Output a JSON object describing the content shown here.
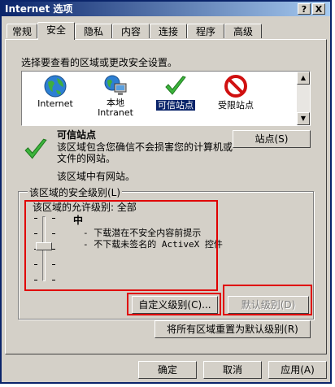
{
  "window": {
    "title": "Internet 选项",
    "help_label": "?",
    "close_label": "X"
  },
  "tabs": [
    {
      "label": "常规"
    },
    {
      "label": "安全"
    },
    {
      "label": "隐私"
    },
    {
      "label": "内容"
    },
    {
      "label": "连接"
    },
    {
      "label": "程序"
    },
    {
      "label": "高级"
    }
  ],
  "active_tab": "安全",
  "security": {
    "instruction": "选择要查看的区域或更改安全设置。",
    "zones": [
      {
        "label": "Internet",
        "icon": "globe-icon"
      },
      {
        "label": "本地\nIntranet",
        "icon": "intranet-icon"
      },
      {
        "label": "可信站点",
        "icon": "checkmark-icon",
        "selected": true
      },
      {
        "label": "受限站点",
        "icon": "restricted-icon"
      }
    ],
    "zone_title": "可信站点",
    "zone_desc_line1": "该区域包含您确信不会损害您的计算机或",
    "zone_desc_line2": "文件的网站。",
    "zone_status": "该区域中有网站。",
    "sites_button": "站点(S)",
    "group_title": "该区域的安全级别(L)",
    "allowed_levels": "该区域的允许级别: 全部",
    "level_name": "中",
    "level_desc_1": "- 下载潜在不安全内容前提示",
    "level_desc_2": "- 不下载未签名的 ActiveX 控件",
    "custom_level_button": "自定义级别(C)...",
    "default_level_button": "默认级别(D)",
    "reset_all_button": "将所有区域重置为默认级别(R)"
  },
  "footer": {
    "ok_label": "确定",
    "cancel_label": "取消",
    "apply_label": "应用(A)"
  },
  "colors": {
    "highlight": "#e00000",
    "titlebar": "#0a246a",
    "selection": "#0a246a",
    "dialog_face": "#d4d0c8"
  }
}
